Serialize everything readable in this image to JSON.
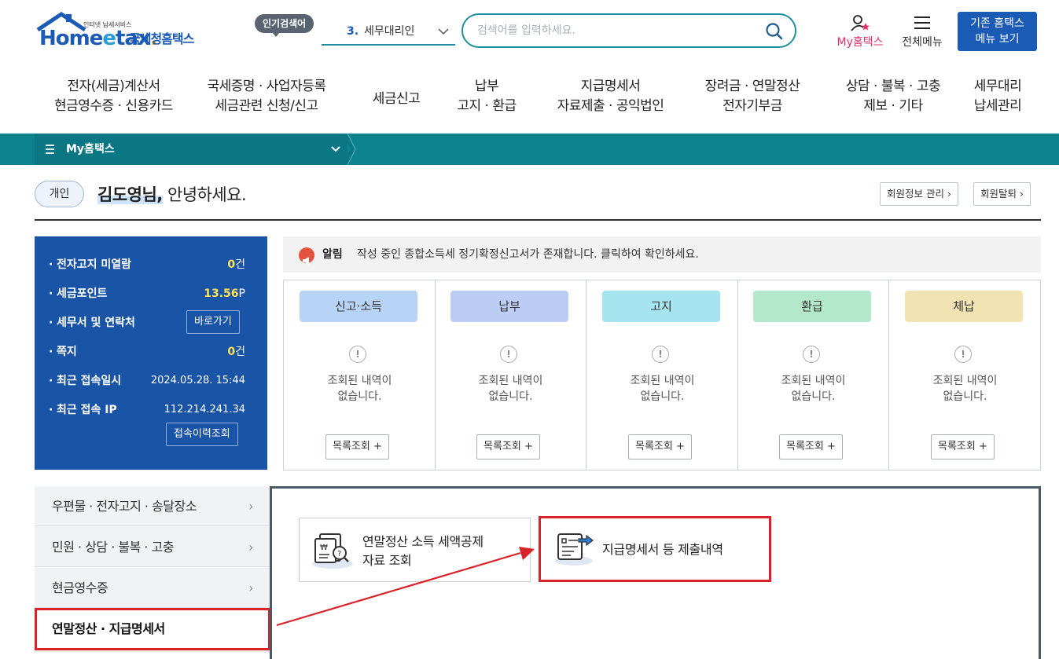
{
  "logo": {
    "sub": "인터넷 납세서비스",
    "home": "Home",
    "e": "e",
    "tax": "tax",
    "dot": ".",
    "agency": "국세청홈택스"
  },
  "popular": {
    "badge": "인기검색어",
    "rank": "3.",
    "term": "세무대리인"
  },
  "search": {
    "placeholder": "검색어를 입력하세요."
  },
  "utility": {
    "my_home": "My홈택스",
    "all_menu": "전체메뉴",
    "legacy_line1": "기존 홈택스",
    "legacy_line2": "메뉴 보기"
  },
  "gnb": [
    {
      "l1": "전자(세금)계산서",
      "l2": "현금영수증 · 신용카드"
    },
    {
      "l1": "국세증명 · 사업자등록",
      "l2": "세금관련 신청/신고"
    },
    {
      "l1": "세금신고",
      "l2": ""
    },
    {
      "l1": "납부",
      "l2": "고지 · 환급"
    },
    {
      "l1": "지급명세서",
      "l2": "자료제출 · 공익법인"
    },
    {
      "l1": "장려금 · 연말정산",
      "l2": "전자기부금"
    },
    {
      "l1": "상담 · 불복 · 고충",
      "l2": "제보 · 기타"
    },
    {
      "l1": "세무대리",
      "l2": "납세관리"
    }
  ],
  "breadcrumb": {
    "label": "My홈택스"
  },
  "greeting": {
    "user_type": "개인",
    "name": "김도영님,",
    "text": " 안녕하세요.",
    "btn_member": "회원정보 관리 ›",
    "btn_withdraw": "회원탈퇴 ›"
  },
  "info": {
    "unread_label": "전자고지 미열람",
    "unread_value": "0",
    "unread_unit": "건",
    "points_label": "세금포인트",
    "points_value": "13.56",
    "points_unit": "P",
    "office_label": "세무서 및 연락처",
    "office_btn": "바로가기",
    "memo_label": "쪽지",
    "memo_value": "0",
    "memo_unit": "건",
    "last_login_label": "최근 접속일시",
    "last_login_value": "2024.05.28.  15:44",
    "last_ip_label": "최근 접속 IP",
    "last_ip_value": "112.214.241.34",
    "history_btn": "접속이력조회"
  },
  "notice": {
    "tag": "알림",
    "message": "작성 중인 종합소득세 정기확정신고서가 존재합니다. 클릭하여 확인하세요."
  },
  "status": [
    {
      "label": "신고·소득",
      "color": "#b7d4f7",
      "empty": "조회된 내역이\n없습니다.",
      "more": "목록조회 +"
    },
    {
      "label": "납부",
      "color": "#bccdf5",
      "empty": "조회된 내역이\n없습니다.",
      "more": "목록조회 +"
    },
    {
      "label": "고지",
      "color": "#a6e4ef",
      "empty": "조회된 내역이\n없습니다.",
      "more": "목록조회 +"
    },
    {
      "label": "환급",
      "color": "#b3e8cb",
      "empty": "조회된 내역이\n없습니다.",
      "more": "목록조회 +"
    },
    {
      "label": "체납",
      "color": "#f2e3b3",
      "empty": "조회된 내역이\n없습니다.",
      "more": "목록조회 +"
    }
  ],
  "status_warn": "!",
  "side_menu": [
    {
      "label": "우편물 · 전자고지 · 송달장소"
    },
    {
      "label": "민원 · 상담 · 불복 · 고충"
    },
    {
      "label": "현금영수증"
    },
    {
      "label": "연말정산 · 지급명세서"
    }
  ],
  "side_chev": "›",
  "cards": {
    "card1_line1": "연말정산 소득 세액공제",
    "card1_line2": "자료 조회",
    "card2": "지급명세서 등 제출내역"
  },
  "colors": {
    "brand_blue": "#1b5bb5",
    "teal": "#0d8390",
    "panel_blue": "#1a54a6",
    "highlight_red": "#d8232a",
    "accent_pink": "#e0306a"
  }
}
